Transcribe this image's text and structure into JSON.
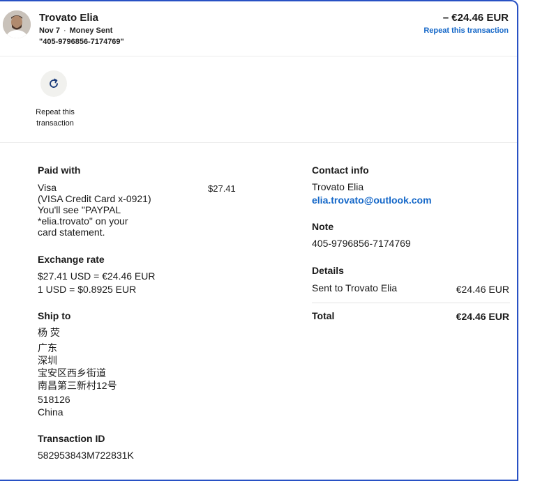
{
  "header": {
    "name": "Trovato Elia",
    "date": "Nov 7",
    "separator": "·",
    "type": "Money Sent",
    "note_ref": "\"405-9796856-7174769\"",
    "amount": "– €24.46 EUR",
    "repeat_link": "Repeat this transaction"
  },
  "actions": {
    "repeat_label": "Repeat this transaction"
  },
  "paid_with": {
    "title": "Paid with",
    "method": "Visa",
    "card": "(VISA Credit Card x-0921)",
    "statement_line1": "You'll see \"PAYPAL",
    "statement_line2": "*elia.trovato\" on your",
    "statement_line3": "card statement.",
    "amount": "$27.41"
  },
  "exchange": {
    "title": "Exchange rate",
    "line1": "$27.41 USD = €24.46 EUR",
    "line2": "1 USD = $0.8925 EUR"
  },
  "ship_to": {
    "title": "Ship to",
    "lines": [
      "杨 荧",
      "广东",
      "深圳",
      "宝安区西乡街道",
      "南昌第三新村12号",
      "518126",
      "China"
    ]
  },
  "transaction": {
    "title": "Transaction ID",
    "id": "582953843M722831K"
  },
  "contact": {
    "title": "Contact info",
    "name": "Trovato Elia",
    "email": "elia.trovato@outlook.com"
  },
  "note": {
    "title": "Note",
    "value": "405-9796856-7174769"
  },
  "details": {
    "title": "Details",
    "label": "Sent to Trovato Elia",
    "amount": "€24.46 EUR"
  },
  "total": {
    "label": "Total",
    "amount": "€24.46 EUR"
  },
  "colors": {
    "accent": "#1467c8",
    "frame": "#2851c4"
  }
}
